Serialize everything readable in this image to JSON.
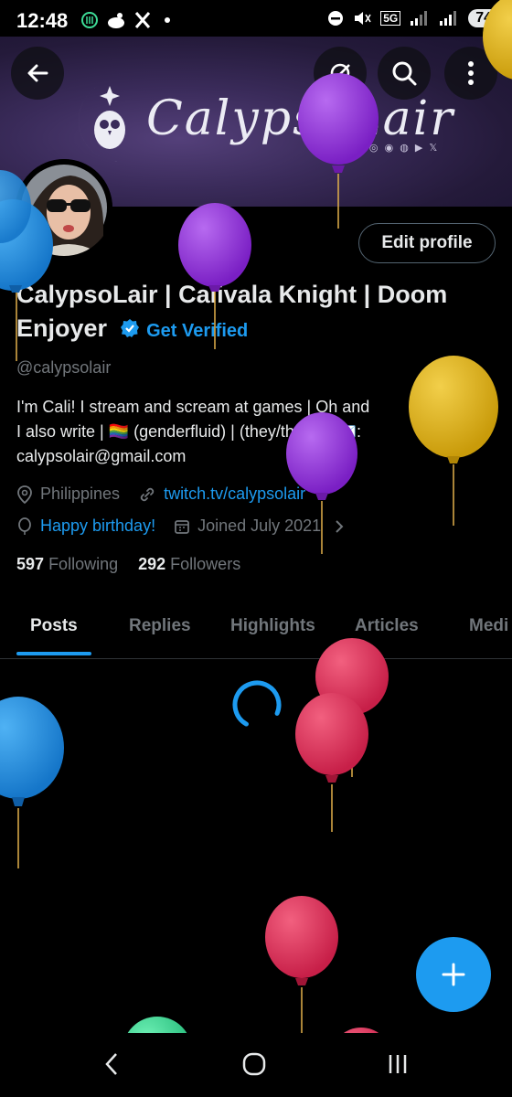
{
  "status_bar": {
    "time": "12:48",
    "left_icons": [
      "notification-icon",
      "chef-icon",
      "x-icon",
      "dot-icon"
    ],
    "network": "5G",
    "battery": "74"
  },
  "banner": {
    "brand_text": "CalypsoLair",
    "social_text": "𝕏 ◎ ◉ ◍ ▶ 𝕏"
  },
  "header_buttons": [
    "back-arrow-icon",
    "grok-icon",
    "search-icon",
    "more-vertical-icon"
  ],
  "profile": {
    "edit_button": "Edit profile",
    "display_name": "CalypsoLair | Calivala Knight | Doom Enjoyer",
    "get_verified": "Get Verified",
    "handle": "@calypsolair",
    "bio_line1": "I'm Cali! I stream and scream at games | Oh and",
    "bio_line2": "I also write | 🏳️‍🌈 (genderfluid) | (they/them) | 📧:",
    "bio_line3": "calypsolair@gmail.com",
    "location": "Philippines",
    "website": "twitch.tv/calypsolair",
    "birthday": "Happy birthday!",
    "joined": "Joined July 2021",
    "following_count": "597",
    "following_label": "Following",
    "followers_count": "292",
    "followers_label": "Followers"
  },
  "tabs": [
    {
      "label": "Posts",
      "active": true
    },
    {
      "label": "Replies",
      "active": false
    },
    {
      "label": "Highlights",
      "active": false
    },
    {
      "label": "Articles",
      "active": false
    },
    {
      "label": "Medi",
      "active": false
    }
  ],
  "colors": {
    "accent": "#1d9bf0",
    "balloon_purple": "#8e2fd6",
    "balloon_red": "#d92f5a",
    "balloon_blue": "#1f8fe0",
    "balloon_yellow": "#e0b214",
    "balloon_green": "#3ddc97"
  }
}
